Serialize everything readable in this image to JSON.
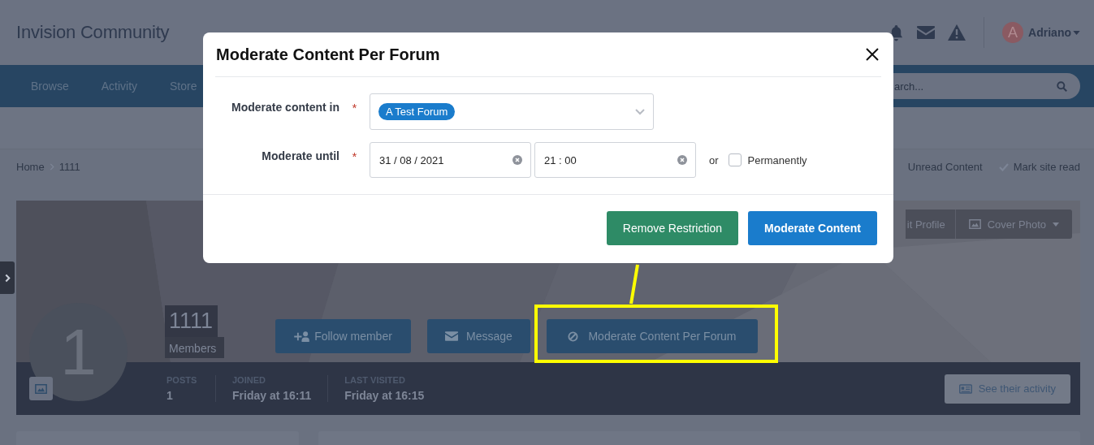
{
  "header": {
    "site_title": "Invision Community",
    "user": {
      "initial": "A",
      "name": "Adriano"
    }
  },
  "nav": {
    "items": [
      {
        "label": "Browse"
      },
      {
        "label": "Activity"
      },
      {
        "label": "Store"
      }
    ],
    "search": {
      "placeholder": "arch..."
    }
  },
  "breadcrumb": [
    "Home",
    "1111"
  ],
  "quick_links": [
    "Unread Content",
    "Mark site read"
  ],
  "profile": {
    "cover_buttons": [
      "it Profile",
      "Cover Photo"
    ],
    "avatar_initial": "1",
    "name": "1111",
    "group": "Members",
    "actions": [
      "Follow member",
      "Message",
      "Moderate Content Per Forum"
    ],
    "stats": [
      {
        "label": "POSTS",
        "value": "1"
      },
      {
        "label": "JOINED",
        "value": "Friday at 16:11"
      },
      {
        "label": "LAST VISITED",
        "value": "Friday at 16:15"
      }
    ],
    "activity_button": "See their activity"
  },
  "modal": {
    "title": "Moderate Content Per Forum",
    "fields": [
      {
        "kind": "select",
        "label": "Moderate content in",
        "required_mark": "*",
        "tokens": [
          "A Test Forum"
        ]
      },
      {
        "kind": "datetime",
        "label": "Moderate until",
        "required_mark": "*",
        "date": "31 / 08 / 2021",
        "time": "21 : 00",
        "or_label": "or",
        "permanent": {
          "label": "Permanently",
          "checked": false
        }
      }
    ],
    "buttons": [
      {
        "label": "Remove Restriction",
        "kind": "secondary"
      },
      {
        "label": "Moderate Content",
        "kind": "primary"
      }
    ]
  }
}
